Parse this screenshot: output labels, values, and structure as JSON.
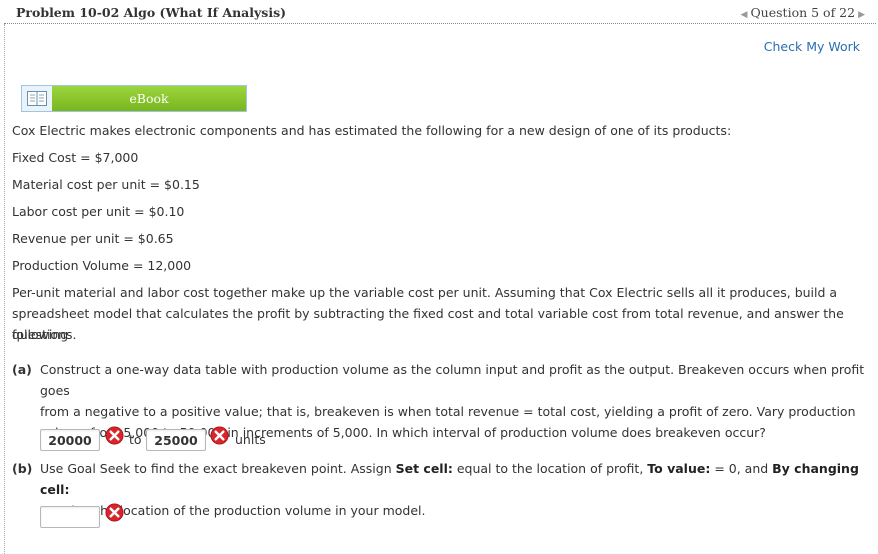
{
  "header": {
    "title": "Problem 10-02 Algo (What If Analysis)",
    "question_label": "Question 5 of 22"
  },
  "check_work": "Check My Work",
  "ebook_label": "eBook",
  "intro": "Cox Electric makes electronic components and has estimated the following for a new design of one of its products:",
  "facts": [
    "Fixed Cost = $7,000",
    "Material cost per unit = $0.15",
    "Labor cost per unit = $0.10",
    "Revenue per unit = $0.65",
    "Production Volume = 12,000"
  ],
  "instructions": {
    "line1": "Per-unit material and labor cost together make up the variable cost per unit. Assuming that Cox Electric sells all it produces, build a",
    "line2": "spreadsheet model that calculates the profit by subtracting the fixed cost and total variable cost from total revenue, and answer the following",
    "line3": "questions."
  },
  "part_a": {
    "tag": "(a)",
    "line1": "Construct a one-way data table with production volume as the column input and profit as the output. Breakeven occurs when profit goes",
    "line2": "from a negative to a positive value; that is, breakeven is when total revenue = total cost, yielding a profit of zero. Vary production",
    "line3": "volume from 5,000 to 50,000 in increments of 5,000. In which interval of production volume does breakeven occur?",
    "answer_low": "20000",
    "to_label": "to",
    "answer_high": "25000",
    "units": "units"
  },
  "part_b": {
    "tag": "(b)",
    "l1a": "Use Goal Seek to find the exact breakeven point. Assign ",
    "set_cell": "Set cell:",
    "l1b": " equal to the location of profit, ",
    "to_value": "To value:",
    "l1c": " = 0, and ",
    "by_changing": "By changing cell:",
    "line2": "equal to the location of the production volume in your model.",
    "answer": ""
  },
  "colors": {
    "link": "#2a6fb0",
    "ebook_green": "#79b51f",
    "error_red": "#d9242c"
  }
}
